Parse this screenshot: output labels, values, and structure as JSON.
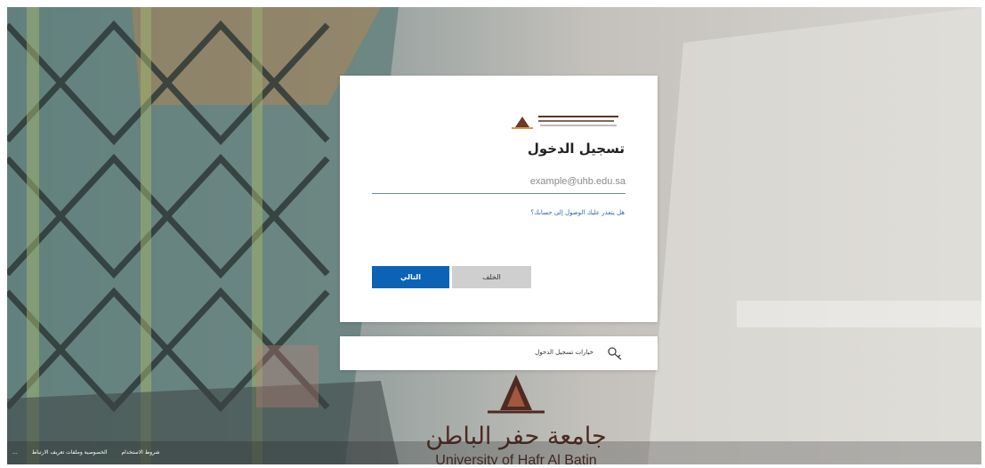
{
  "login": {
    "title": "تسجيل الدخول",
    "email_placeholder": "example@uhb.edu.sa",
    "help_link": "هل يتعذر عليك الوصول إلى حسابك؟",
    "back_label": "الخلف",
    "next_label": "التالي"
  },
  "signin_options": {
    "label": "خيارات تسجيل الدخول",
    "icon": "key-icon"
  },
  "brand": {
    "name_ar": "جامعة حفر الباطن",
    "name_en": "University of Hafr Al Batin"
  },
  "footer": {
    "terms": "شروط الاستخدام",
    "privacy": "الخصوصية وملفات تعريف الارتباط",
    "more": "..."
  },
  "colors": {
    "primary_button": "#0c63b5",
    "secondary_button": "#cfcfcf",
    "link": "#2f5fb3",
    "brand": "#4e2a22"
  }
}
